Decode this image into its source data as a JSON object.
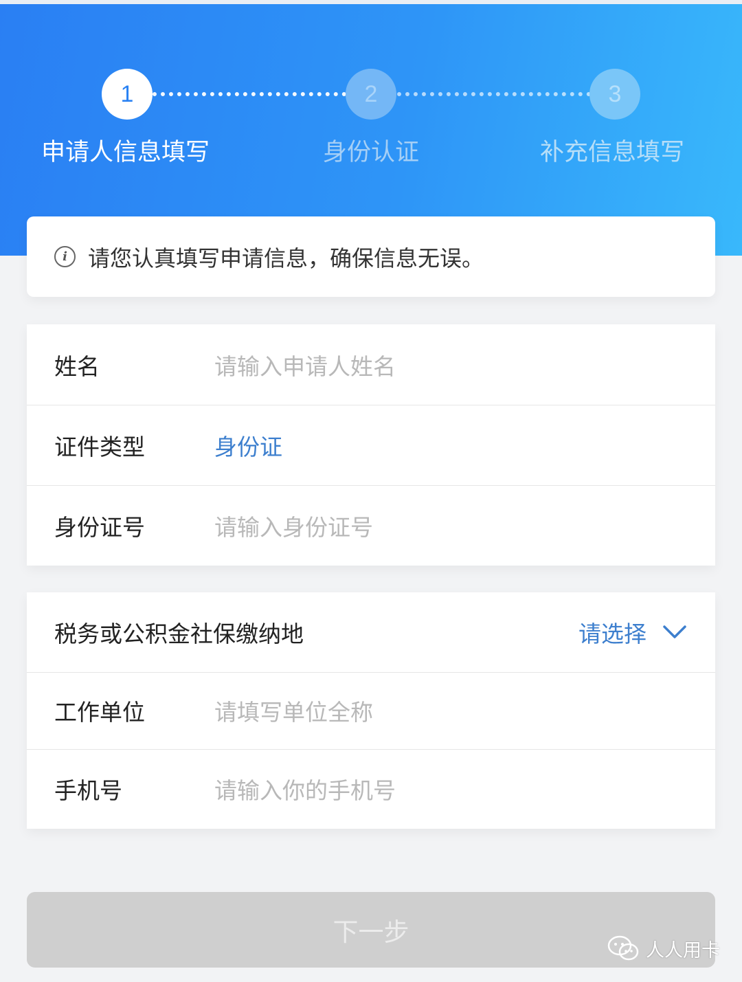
{
  "steps": [
    {
      "number": "1",
      "label": "申请人信息填写"
    },
    {
      "number": "2",
      "label": "身份认证"
    },
    {
      "number": "3",
      "label": "补充信息填写"
    }
  ],
  "notice": {
    "icon": "info-icon",
    "text": "请您认真填写申请信息，确保信息无误。"
  },
  "form_section_1": {
    "name": {
      "label": "姓名",
      "placeholder": "请输入申请人姓名"
    },
    "id_type": {
      "label": "证件类型",
      "value": "身份证"
    },
    "id_number": {
      "label": "身份证号",
      "placeholder": "请输入身份证号"
    }
  },
  "form_section_2": {
    "location": {
      "label": "税务或公积金社保缴纳地",
      "value": "请选择",
      "icon": "chevron-down-icon"
    },
    "employer": {
      "label": "工作单位",
      "placeholder": "请填写单位全称"
    },
    "phone": {
      "label": "手机号",
      "placeholder": "请输入你的手机号"
    }
  },
  "next_button": {
    "label": "下一步"
  },
  "watermark": {
    "text": "人人用卡",
    "icon": "wechat-icon"
  },
  "colors": {
    "header_start": "#2a7ff3",
    "header_end": "#39b8fb",
    "accent": "#3d7fce",
    "placeholder": "#b8b8b8",
    "button_disabled": "#cfcfcf",
    "background": "#f2f3f5"
  }
}
